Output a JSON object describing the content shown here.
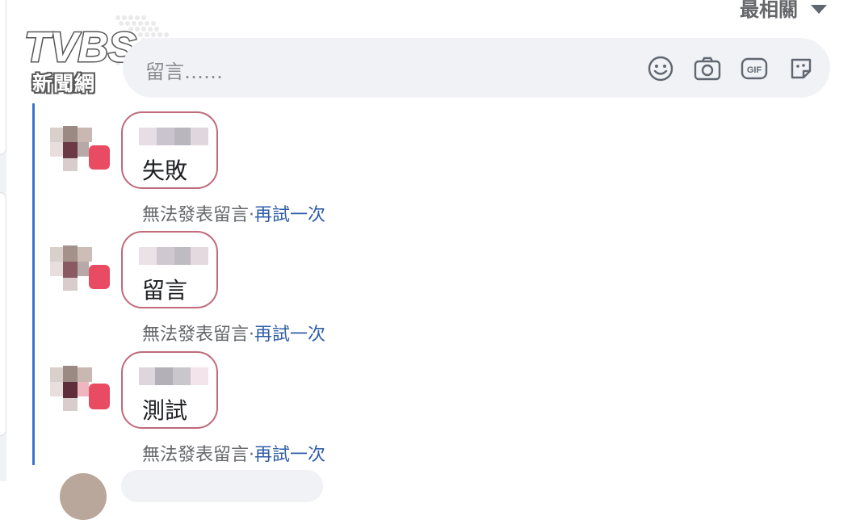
{
  "watermark": {
    "brand": "TVBS",
    "sub": "新聞網"
  },
  "sort": {
    "label": "最相關",
    "icon": "caret-down-icon"
  },
  "composer": {
    "placeholder": "留言……",
    "tools": [
      {
        "name": "emoji-icon"
      },
      {
        "name": "camera-icon"
      },
      {
        "name": "gif-icon",
        "label": "GIF"
      },
      {
        "name": "sticker-icon"
      }
    ]
  },
  "comments": [
    {
      "text": "失敗",
      "error": "無法發表留言",
      "separator": "·",
      "retry": "再試一次"
    },
    {
      "text": "留言",
      "error": "無法發表留言",
      "separator": "·",
      "retry": "再試一次"
    },
    {
      "text": "測試",
      "error": "無法發表留言",
      "separator": "·",
      "retry": "再試一次"
    }
  ],
  "colors": {
    "accent": "#3b6fd0",
    "link": "#2f5ea8",
    "bubble_border": "#c06a7a",
    "composer_bg": "#f0f2f5",
    "secondary_text": "#65676b"
  }
}
